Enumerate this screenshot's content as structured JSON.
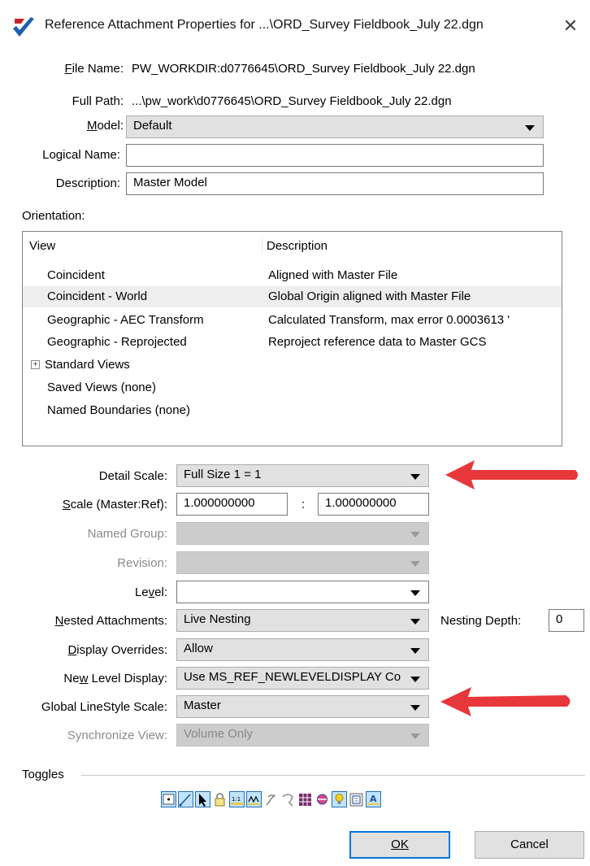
{
  "window": {
    "title": "Reference Attachment Properties for ...\\ORD_Survey Fieldbook_July 22.dgn",
    "close_glyph": "✕"
  },
  "fields": {
    "file_name_label": "File Name:",
    "file_name_value": "PW_WORKDIR:d0776645\\ORD_Survey Fieldbook_July 22.dgn",
    "full_path_label": "Full Path:",
    "full_path_value": "...\\pw_work\\d0776645\\ORD_Survey Fieldbook_July 22.dgn",
    "model_label": "Model:",
    "model_value": "Default",
    "logical_name_label": "Logical Name:",
    "logical_name_value": "",
    "description_label": "Description:",
    "description_value": "Master Model"
  },
  "orientation": {
    "label": "Orientation:",
    "col_view": "View",
    "col_description": "Description",
    "rows": [
      {
        "view": "Coincident",
        "description": "Aligned with Master File"
      },
      {
        "view": "Coincident - World",
        "description": "Global Origin aligned with Master File"
      },
      {
        "view": "Geographic - AEC Transform",
        "description": "Calculated Transform, max error 0.0003613 '"
      },
      {
        "view": "Geographic - Reprojected",
        "description": "Reproject reference data to Master GCS"
      }
    ],
    "standard_views": "Standard Views",
    "saved_views": "Saved Views (none)",
    "named_boundaries": "Named Boundaries (none)",
    "expander_glyph": "+"
  },
  "settings": {
    "detail_scale_label": "Detail Scale:",
    "detail_scale_value": "Full Size 1 = 1",
    "scale_label": "Scale (Master:Ref):",
    "scale_master": "1.000000000",
    "scale_colon": ":",
    "scale_ref": "1.000000000",
    "named_group_label": "Named Group:",
    "revision_label": "Revision:",
    "level_label": "Level:",
    "nested_attachments_label": "Nested Attachments:",
    "nested_attachments_value": "Live Nesting",
    "nesting_depth_label": "Nesting Depth:",
    "nesting_depth_value": "0",
    "display_overrides_label": "Display Overrides:",
    "display_overrides_value": "Allow",
    "new_level_display_label": "New Level Display:",
    "new_level_display_value": "Use MS_REF_NEWLEVELDISPLAY Co",
    "global_linestyle_label": "Global LineStyle Scale:",
    "global_linestyle_value": "Master",
    "synchronize_view_label": "Synchronize View:",
    "synchronize_view_value": "Volume Only"
  },
  "toggles": {
    "label": "Toggles",
    "icons": [
      "display-toggle-icon",
      "snap-toggle-icon",
      "locate-toggle-icon",
      "lock-toggle-icon",
      "true-scale-toggle-icon",
      "scale-linestyles-toggle-icon",
      "ignore-attachments-toggle-icon",
      "ignore-elevation-toggle-icon",
      "treat-as-element-toggle-icon",
      "display-raster-toggle-icon",
      "use-lights-toggle-icon",
      "clip-toggle-icon",
      "annotation-scale-toggle-icon"
    ]
  },
  "buttons": {
    "ok": "OK",
    "cancel": "Cancel"
  },
  "colors": {
    "arrow_red": "#e8373a",
    "selection_blue": "#0078d7",
    "combo_bg": "#e1e1e1",
    "disabled_bg": "#cccccc"
  }
}
